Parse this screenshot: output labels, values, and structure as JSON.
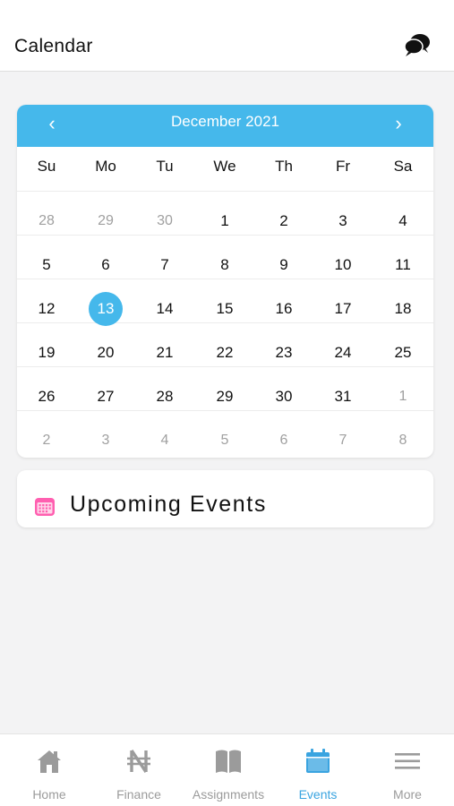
{
  "header": {
    "title": "Calendar",
    "chat_icon": "chat-bubbles-icon"
  },
  "calendar": {
    "month_label": "December 2021",
    "prev_icon": "chevron-left-icon",
    "next_icon": "chevron-right-icon",
    "accent_color": "#45b8eb",
    "weekdays": [
      "Su",
      "Mo",
      "Tu",
      "We",
      "Th",
      "Fr",
      "Sa"
    ],
    "weeks": [
      [
        "28",
        "29",
        "30",
        "1",
        "2",
        "3",
        "4"
      ],
      [
        "5",
        "6",
        "7",
        "8",
        "9",
        "10",
        "11"
      ],
      [
        "12",
        "13",
        "14",
        "15",
        "16",
        "17",
        "18"
      ],
      [
        "19",
        "20",
        "21",
        "22",
        "23",
        "24",
        "25"
      ],
      [
        "26",
        "27",
        "28",
        "29",
        "30",
        "31",
        "1"
      ],
      [
        "2",
        "3",
        "4",
        "5",
        "6",
        "7",
        "8"
      ]
    ],
    "selected_day": "13"
  },
  "events": {
    "title": "Upcoming Events",
    "icon": "calendar-icon"
  },
  "tabbar": {
    "items": [
      {
        "label": "Home",
        "icon": "home-icon"
      },
      {
        "label": "Finance",
        "icon": "naira-icon"
      },
      {
        "label": "Assignments",
        "icon": "book-icon"
      },
      {
        "label": "Events",
        "icon": "calendar-icon"
      },
      {
        "label": "More",
        "icon": "menu-icon"
      }
    ],
    "active_index": 3,
    "active_color": "#3aa4e0"
  }
}
